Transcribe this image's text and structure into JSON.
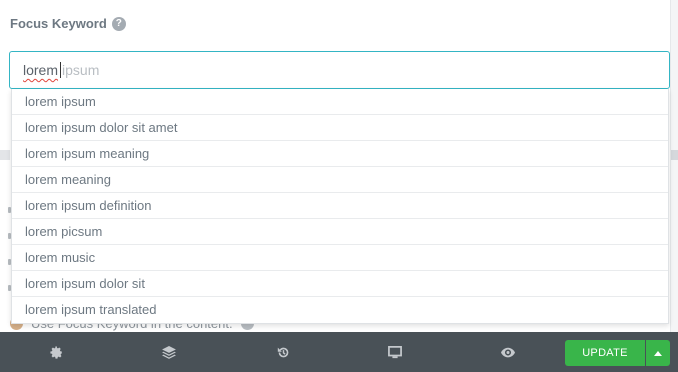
{
  "focus_keyword": {
    "label": "Focus Keyword",
    "help_icon": "question-mark-icon",
    "input_value": "lorem ",
    "autocomplete_ghost": "ipsum"
  },
  "suggestions": [
    "lorem ipsum",
    "lorem ipsum dolor sit amet",
    "lorem ipsum meaning",
    "lorem meaning",
    "lorem ipsum definition",
    "lorem picsum",
    "lorem music",
    "lorem ipsum dolor sit",
    "lorem ipsum translated"
  ],
  "obscured_row": {
    "text": "Use Focus Keyword in the content."
  },
  "footer": {
    "icons": [
      "settings-icon",
      "layers-icon",
      "history-icon",
      "responsive-icon",
      "preview-icon"
    ],
    "update_label": "UPDATE",
    "accent": "#39b54a"
  },
  "colors": {
    "input_border": "#34b5c4",
    "footer_bg": "#495157"
  }
}
